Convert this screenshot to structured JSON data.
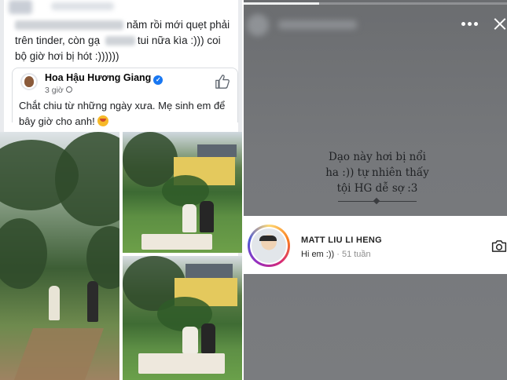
{
  "facebook_post": {
    "text_part1": "năm rồi mới quẹt phải trên tinder, còn gạ",
    "text_part2": "tui nữa kìa :))) coi bộ giờ hơi bị hót :))))))",
    "shared_post": {
      "author": "Hoa Hậu Hương Giang",
      "time": "3 giờ",
      "text": "Chắt chiu từ những ngày xưa. Mẹ sinh em để bây giờ cho anh!"
    }
  },
  "story": {
    "caption_line1": "Dạo này hơi bị nổi",
    "caption_line2": "ha :)) tự nhiên thấy",
    "caption_line3": "tội HG dễ sợ :3",
    "mention": {
      "name": "MATT LIU LI HENG",
      "message": "Hi em :))",
      "time": "· 51 tuần"
    }
  },
  "icons": {
    "verified": "verified-badge-icon",
    "like": "thumbs-up-icon",
    "globe": "globe-icon",
    "more": "more-dots-icon",
    "close": "close-icon",
    "camera": "camera-icon"
  },
  "colors": {
    "facebook_blue": "#1877f2",
    "story_background": "#76787b"
  }
}
